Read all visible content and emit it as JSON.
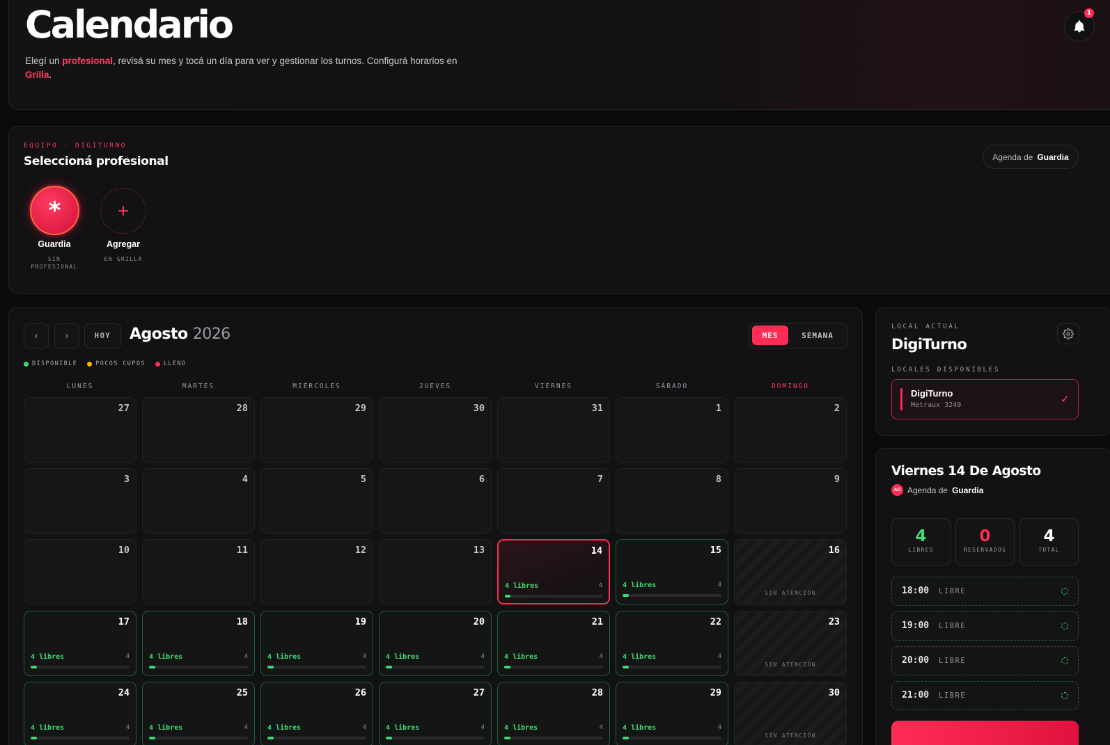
{
  "header": {
    "title": "Calendario",
    "desc_1": "Elegí un ",
    "desc_hl_1": "profesional",
    "desc_2": ", revisá su mes y tocá un día para ver y gestionar los turnos. Configurá horarios en ",
    "desc_hl_2": "Grilla",
    "desc_3": ".",
    "notification_count": "1"
  },
  "team": {
    "eyebrow": "EQUIPO · DIGITURNO",
    "title": "Seleccioná profesional",
    "agenda_prefix": "Agenda de",
    "agenda_name": "Guardia",
    "members": [
      {
        "name": "Guardia",
        "sub_1": "SIN",
        "sub_2": "PROFESIONAL",
        "glyph": "*"
      },
      {
        "name": "Agregar",
        "sub_1": "EN GRILLA",
        "glyph": "+"
      }
    ]
  },
  "calendar": {
    "prev": "‹",
    "next": "›",
    "today": "HOY",
    "month": "Agosto",
    "year": "2026",
    "view_month": "MES",
    "view_week": "SEMANA",
    "legend": [
      {
        "label": "DISPONIBLE",
        "color": "#3ddc71"
      },
      {
        "label": "POCOS CUPOS",
        "color": "#f5b800"
      },
      {
        "label": "LLENO",
        "color": "#ff2d55"
      }
    ],
    "weekdays": [
      "LUNES",
      "MARTES",
      "MIÉRCOLES",
      "JUEVES",
      "VIERNES",
      "SÁBADO",
      "DOMINGO"
    ],
    "free_suffix": "libres",
    "closed_label": "SIN ATENCIÓN",
    "weeks": [
      [
        {
          "n": "27"
        },
        {
          "n": "28"
        },
        {
          "n": "29"
        },
        {
          "n": "30"
        },
        {
          "n": "31"
        },
        {
          "n": "1"
        },
        {
          "n": "2"
        }
      ],
      [
        {
          "n": "3"
        },
        {
          "n": "4"
        },
        {
          "n": "5"
        },
        {
          "n": "6"
        },
        {
          "n": "7"
        },
        {
          "n": "8"
        },
        {
          "n": "9"
        }
      ],
      [
        {
          "n": "10"
        },
        {
          "n": "11"
        },
        {
          "n": "12"
        },
        {
          "n": "13"
        },
        {
          "n": "14",
          "state": "today",
          "free": "4",
          "cap": "4"
        },
        {
          "n": "15",
          "state": "avail",
          "free": "4",
          "cap": "4"
        },
        {
          "n": "16",
          "state": "closed"
        }
      ],
      [
        {
          "n": "17",
          "state": "avail",
          "free": "4",
          "cap": "4"
        },
        {
          "n": "18",
          "state": "avail",
          "free": "4",
          "cap": "4"
        },
        {
          "n": "19",
          "state": "avail",
          "free": "4",
          "cap": "4"
        },
        {
          "n": "20",
          "state": "avail",
          "free": "4",
          "cap": "4"
        },
        {
          "n": "21",
          "state": "avail",
          "free": "4",
          "cap": "4"
        },
        {
          "n": "22",
          "state": "avail",
          "free": "4",
          "cap": "4"
        },
        {
          "n": "23",
          "state": "closed"
        }
      ],
      [
        {
          "n": "24",
          "state": "avail",
          "free": "4",
          "cap": "4"
        },
        {
          "n": "25",
          "state": "avail",
          "free": "4",
          "cap": "4"
        },
        {
          "n": "26",
          "state": "avail",
          "free": "4",
          "cap": "4"
        },
        {
          "n": "27",
          "state": "avail",
          "free": "4",
          "cap": "4"
        },
        {
          "n": "28",
          "state": "avail",
          "free": "4",
          "cap": "4"
        },
        {
          "n": "29",
          "state": "avail",
          "free": "4",
          "cap": "4"
        },
        {
          "n": "30",
          "state": "closed"
        }
      ]
    ]
  },
  "local": {
    "label": "LOCAL ACTUAL",
    "name": "DigiTurno",
    "available_label": "LOCALES DISPONIBLES",
    "item_name": "DigiTurno",
    "item_address": "Metraux 3249"
  },
  "day_detail": {
    "title": "Viernes 14 De Agosto",
    "avatar_initials": "AD",
    "agenda_prefix": "Agenda de",
    "agenda_name": "Guardia",
    "stats": [
      {
        "value": "4",
        "label": "LIBRES",
        "color": "#3ddc71"
      },
      {
        "value": "0",
        "label": "RESERVADOS",
        "color": "#ff2d55"
      },
      {
        "value": "4",
        "label": "TOTAL",
        "color": "#ffffff"
      }
    ],
    "slots": [
      {
        "time": "18:00",
        "status": "LIBRE"
      },
      {
        "time": "19:00",
        "status": "LIBRE"
      },
      {
        "time": "20:00",
        "status": "LIBRE"
      },
      {
        "time": "21:00",
        "status": "LIBRE"
      }
    ]
  }
}
